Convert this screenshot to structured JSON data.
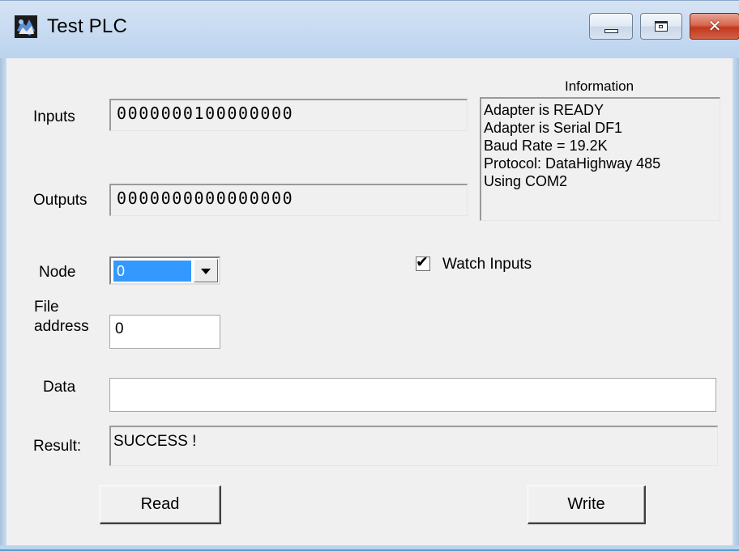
{
  "window": {
    "title": "Test  PLC",
    "close_glyph": "✕",
    "icons": [
      "app-icon",
      "minimize-icon",
      "maximize-icon",
      "close-icon"
    ]
  },
  "inputs": {
    "label": "Inputs",
    "value": "0000000100000000"
  },
  "outputs": {
    "label": "Outputs",
    "value": "0000000000000000"
  },
  "information": {
    "title": "Information",
    "lines": [
      "Adapter is READY",
      "Adapter is Serial DF1",
      "Baud Rate = 19.2K",
      "Protocol: DataHighway 485",
      "Using COM2"
    ]
  },
  "node": {
    "label": "Node",
    "value": "0"
  },
  "watch_inputs": {
    "label": "Watch Inputs",
    "checked": true,
    "check_glyph": "✔"
  },
  "file_address": {
    "label_line1": "File",
    "label_line2": "address",
    "value": "0"
  },
  "data_field": {
    "label": "Data",
    "value": ""
  },
  "result": {
    "label": "Result:",
    "value": "SUCCESS !"
  },
  "buttons": {
    "read": "Read",
    "write": "Write"
  }
}
